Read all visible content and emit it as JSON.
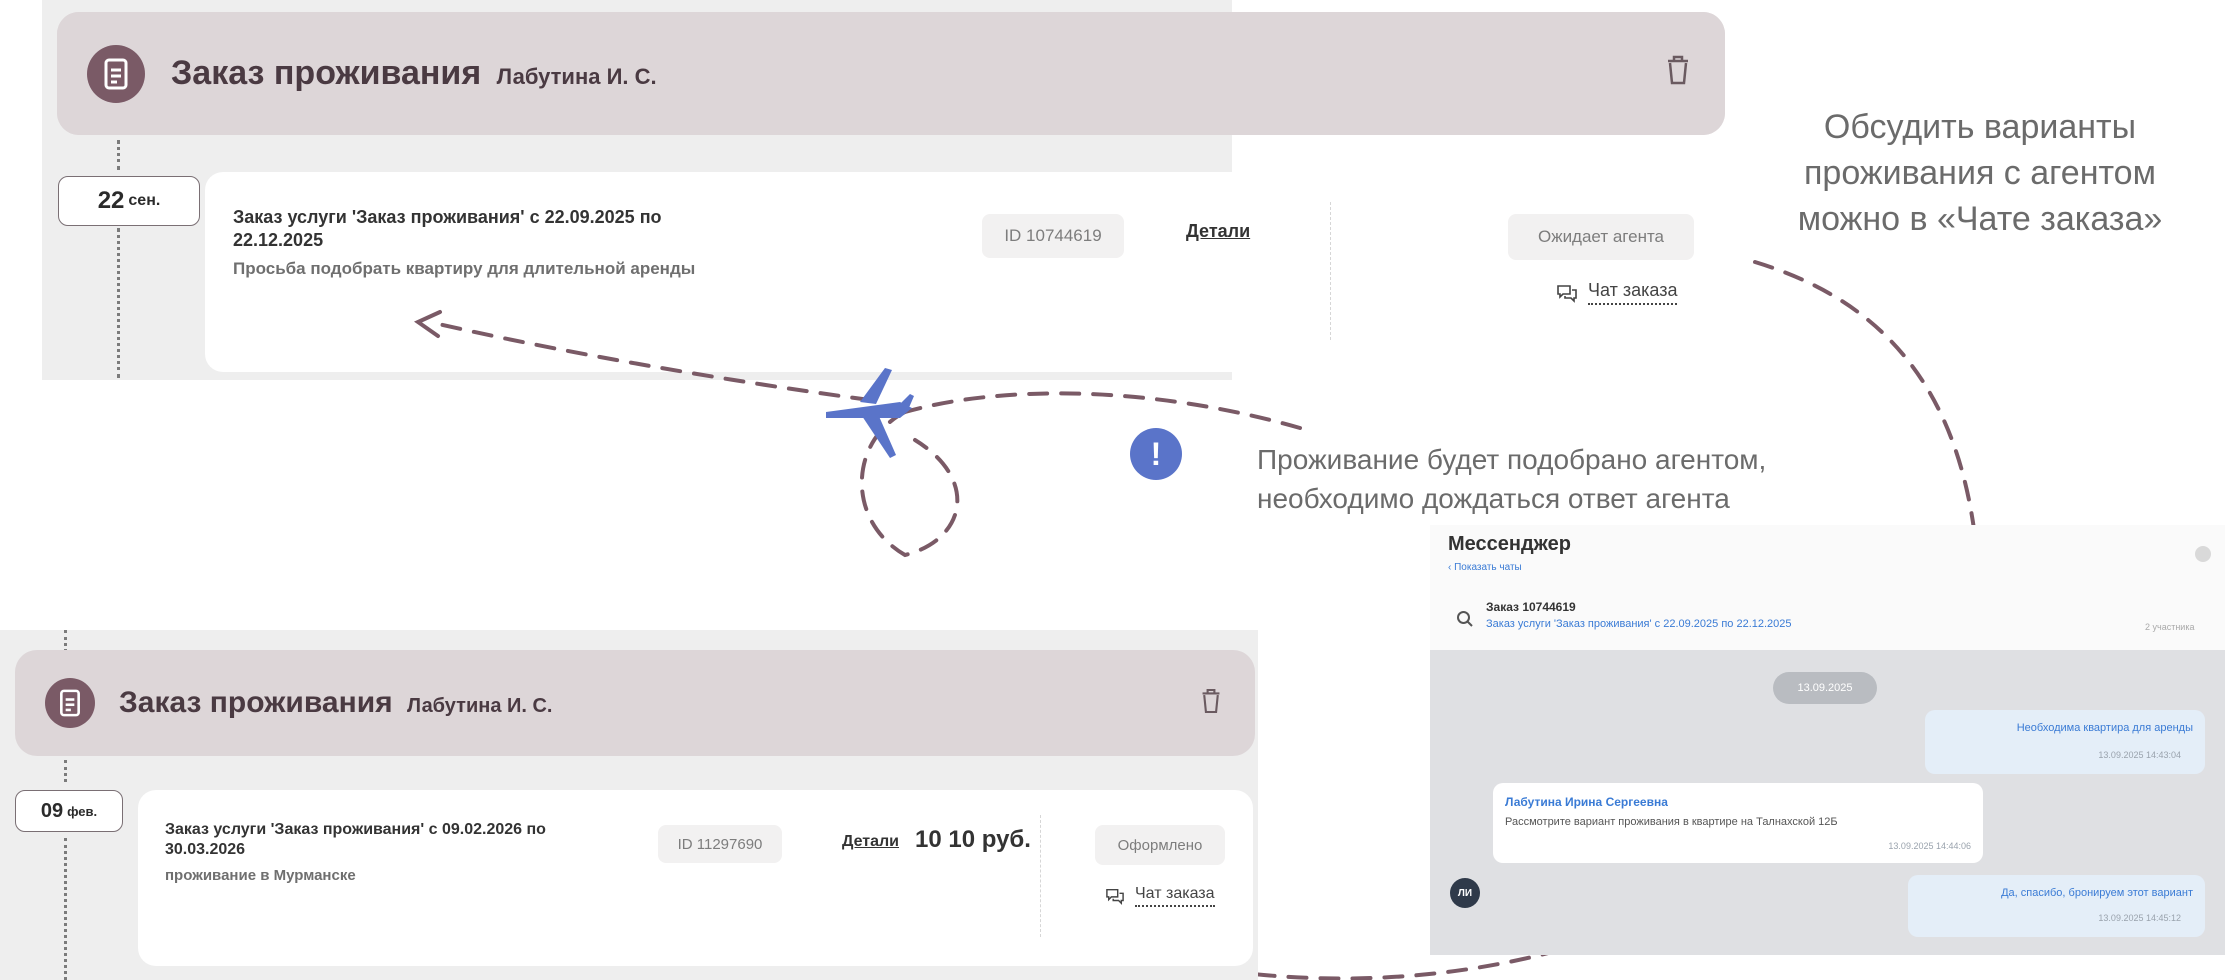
{
  "top": {
    "title": "Заказ проживания",
    "person": "Лабутина И. С.",
    "date_day": "22",
    "date_month": "сен.",
    "order_title": "Заказ услуги 'Заказ проживания' с 22.09.2025 по 22.12.2025",
    "order_desc": "Просьба подобрать квартиру для длительной аренды",
    "id_label": "ID 10744619",
    "details": "Детали",
    "status": "Ожидает агента",
    "chat": "Чат заказа"
  },
  "bottom": {
    "title": "Заказ проживания",
    "person": "Лабутина И. С.",
    "date_day": "09",
    "date_month": "фев.",
    "order_title": "Заказ услуги 'Заказ проживания' с 09.02.2026 по 30.03.2026",
    "order_desc": "проживание в Мурманске",
    "id_label": "ID 11297690",
    "details": "Детали",
    "price": "10 10 руб.",
    "status": "Оформлено",
    "chat": "Чат заказа"
  },
  "annotations": {
    "right_note": "Обсудить варианты проживания с агентом можно в «Чате заказа»",
    "middle_note_line1": "Проживание будет подобрано агентом,",
    "middle_note_line2": "необходимо дождаться ответ агента",
    "warn_symbol": "!"
  },
  "messenger": {
    "title": "Мессенджер",
    "back": "Показать чаты",
    "order_name": "Заказ 10744619",
    "order_sub": "Заказ услуги 'Заказ проживания' с 22.09.2025 по 22.12.2025",
    "participants": "2 участника",
    "date_chip": "13.09.2025",
    "msg1_text": "Необходима квартира для аренды",
    "msg1_time": "13.09.2025 14:43:04",
    "msg2_author": "Лабутина Ирина Сергеевна",
    "msg2_text": "Рассмотрите вариант проживания в квартире на Талнахской 12Б",
    "msg2_time": "13.09.2025 14:44:06",
    "msg2_avatar": "ЛИ",
    "msg3_text": "Да, спасибо, бронируем этот вариант",
    "msg3_time": "13.09.2025 14:45:12"
  },
  "colors": {
    "header_bg": "#ddd6d8",
    "icon_bg": "#7a5a66",
    "arrow": "#7a5a66",
    "plane": "#5a74c9",
    "link_blue": "#3a7bd5"
  }
}
